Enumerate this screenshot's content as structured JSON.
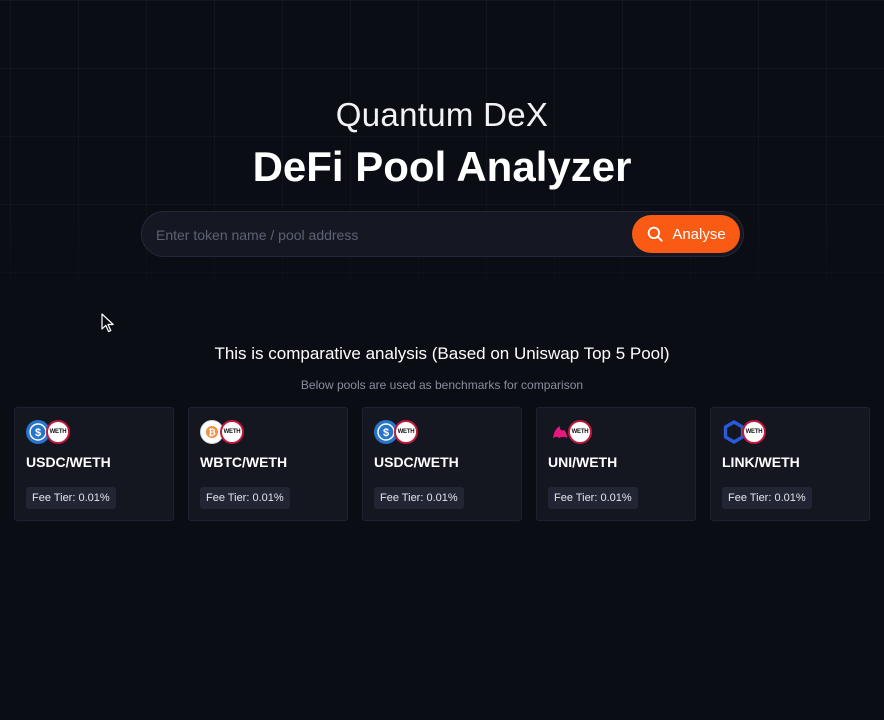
{
  "hero": {
    "subtitle": "Quantum DeX",
    "title": "DeFi Pool Analyzer"
  },
  "search": {
    "placeholder": "Enter token name / pool address",
    "value": "",
    "button_label": "Analyse",
    "button_icon": "search-icon"
  },
  "section": {
    "heading": "This is comparative analysis (Based on Uniswap Top 5 Pool)",
    "subheading": "Below pools are used as benchmarks for comparison"
  },
  "pools": [
    {
      "name": "USDC/WETH",
      "fee": "Fee Tier: 0.01%",
      "token_icon": "usdc-icon",
      "pair_icon": "weth-icon",
      "pair_label": "WETH"
    },
    {
      "name": "WBTC/WETH",
      "fee": "Fee Tier: 0.01%",
      "token_icon": "wbtc-icon",
      "pair_icon": "weth-icon",
      "pair_label": "WETH"
    },
    {
      "name": "USDC/WETH",
      "fee": "Fee Tier: 0.01%",
      "token_icon": "usdc-icon",
      "pair_icon": "weth-icon",
      "pair_label": "WETH"
    },
    {
      "name": "UNI/WETH",
      "fee": "Fee Tier: 0.01%",
      "token_icon": "uni-icon",
      "pair_icon": "weth-icon",
      "pair_label": "WETH"
    },
    {
      "name": "LINK/WETH",
      "fee": "Fee Tier: 0.01%",
      "token_icon": "link-icon",
      "pair_icon": "weth-icon",
      "pair_label": "WETH"
    }
  ],
  "colors": {
    "background": "#0b0d14",
    "accent": "#f95a14",
    "card": "#141720",
    "badge": "#222634",
    "usdc": "#2775ca",
    "weth_ring": "#c1193b",
    "uni": "#e8197d",
    "link": "#2a5ada",
    "wbtc": "#f09242"
  }
}
